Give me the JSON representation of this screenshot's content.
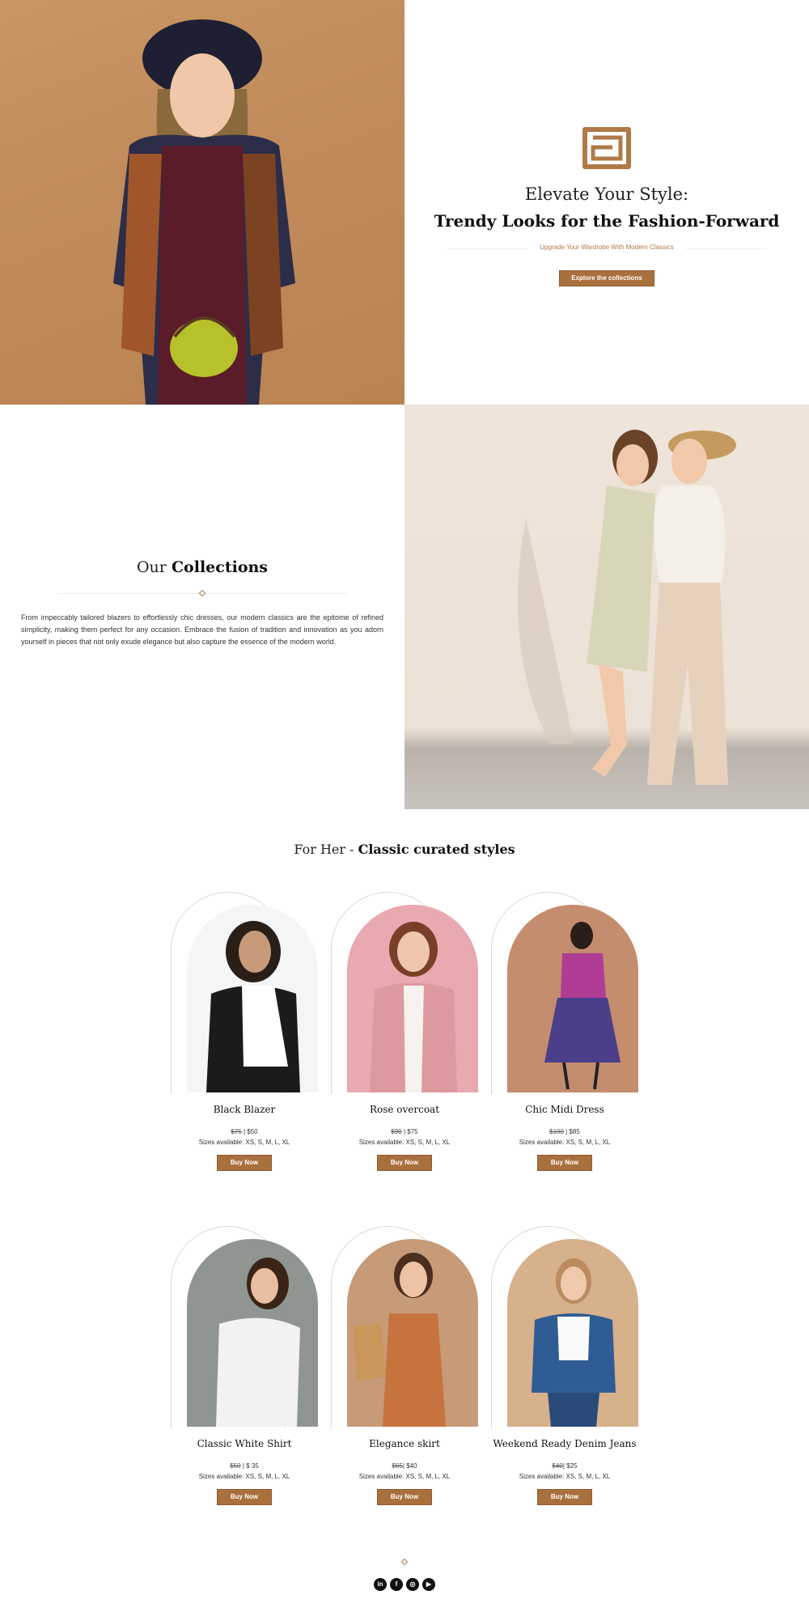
{
  "hero": {
    "title_line1": "Elevate Your Style:",
    "title_line2": "Trendy Looks for the Fashion-Forward",
    "subtitle": "Upgrade Your Wardrobe With Modern Classics",
    "cta_label": "Explore the collections",
    "accent_color": "#a8703d"
  },
  "collections": {
    "title_regular": "Our",
    "title_bold": "Collections",
    "description": "From impeccably tailored blazers to effortlessly chic dresses, our modern classics are the epitome of refined simplicity, making them perfect for any occasion. Embrace the fusion of tradition and innovation as you adorn yourself in pieces that not only exude elegance but also capture the essence of the modern world."
  },
  "for_her": {
    "title_regular": "For Her -",
    "title_bold": "Classic curated styles"
  },
  "products": [
    {
      "name": "Black Blazer",
      "old_price": "$75",
      "price_sep": " | ",
      "price": "$50",
      "sizes": "Sizes available: XS, S, M, L, XL",
      "buy_label": "Buy Now"
    },
    {
      "name": "Rose overcoat",
      "old_price": "$90",
      "price_sep": " | ",
      "price": "$75",
      "sizes": "Sizes available: XS, S, M, L, XL",
      "buy_label": "Buy Now"
    },
    {
      "name": "Chic Midi Dress",
      "old_price": "$100",
      "price_sep": " | ",
      "price": "$85",
      "sizes": "Sizes available: XS, S, M, L, XL",
      "buy_label": "Buy Now"
    },
    {
      "name": "Classic White Shirt",
      "old_price": "$50",
      "price_sep": " | ",
      "price": "$ 35",
      "sizes": "Sizes available: XS, S, M, L, XL",
      "buy_label": "Buy Now"
    },
    {
      "name": "Elegance skirt",
      "old_price": "$65",
      "price_sep": "| ",
      "price": "$40",
      "sizes": "Sizes available: XS, S, M, L, XL",
      "buy_label": "Buy Now"
    },
    {
      "name": "Weekend Ready Denim Jeans",
      "old_price": "$40",
      "price_sep": "| ",
      "price": "$25",
      "sizes": "Sizes available: XS, S, M, L, XL",
      "buy_label": "Buy Now"
    }
  ],
  "footer": {
    "socials": [
      {
        "icon": "linkedin-icon",
        "glyph": "in"
      },
      {
        "icon": "facebook-icon",
        "glyph": "f"
      },
      {
        "icon": "instagram-icon",
        "glyph": "◎"
      },
      {
        "icon": "youtube-icon",
        "glyph": "▶"
      }
    ]
  }
}
